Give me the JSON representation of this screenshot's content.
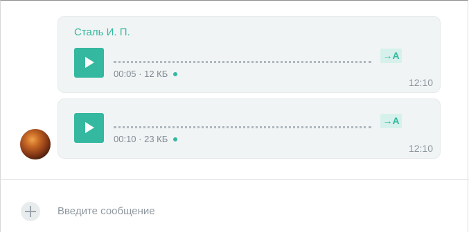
{
  "messages": [
    {
      "sender": "Сталь И. П.",
      "duration": "00:05",
      "size": "12 КБ",
      "meta": "00:05 · 12 КБ",
      "translate_label": "→A",
      "time": "12:10"
    },
    {
      "sender": "",
      "duration": "00:10",
      "size": "23 КБ",
      "meta": "00:10 · 23 КБ",
      "translate_label": "→A",
      "time": "12:10"
    }
  ],
  "composer": {
    "placeholder": "Введите сообщение"
  },
  "colors": {
    "accent": "#34b8a0",
    "bubble": "#f1f4f4"
  },
  "icons": {
    "play": "play-icon",
    "translate": "translate-icon",
    "add": "plus-icon"
  }
}
